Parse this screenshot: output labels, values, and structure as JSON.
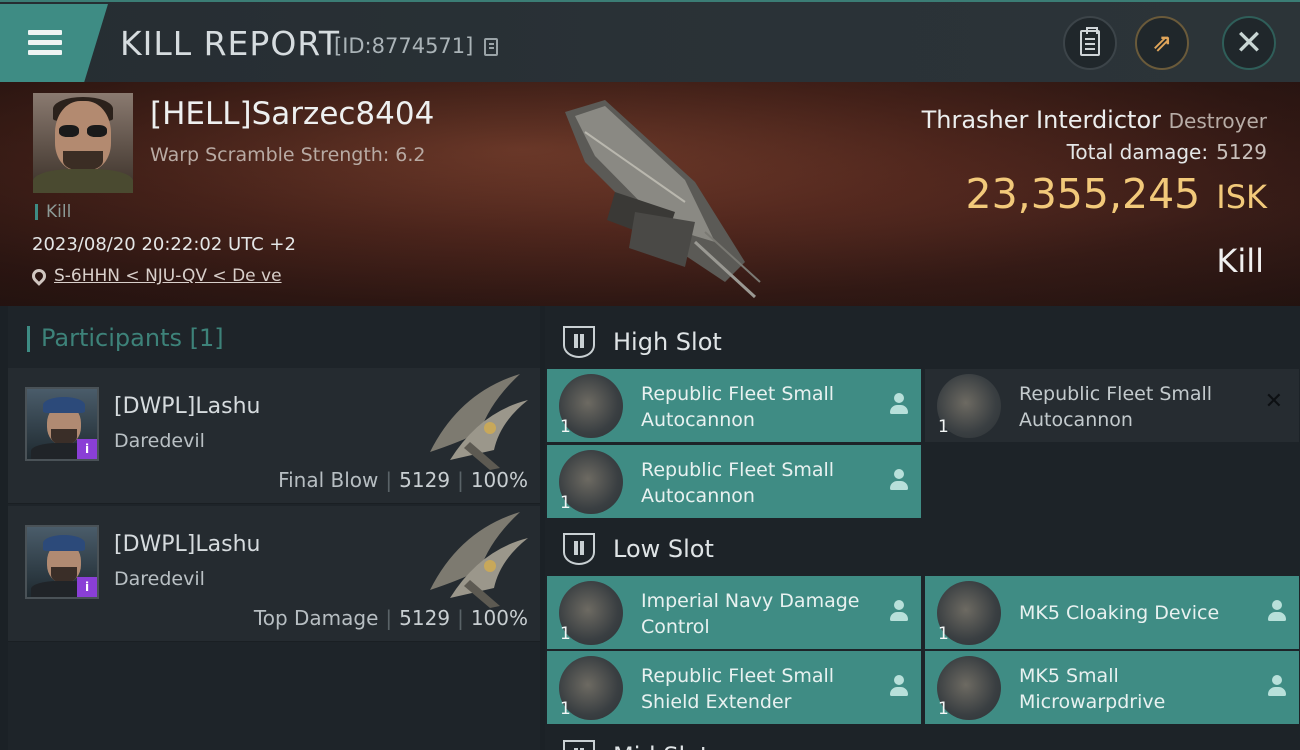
{
  "header": {
    "title": "KILL REPORT",
    "report_id": "[ID:8774571]",
    "menu_icon": "hamburger-menu-icon",
    "buttons": [
      {
        "icon": "clipboard-icon"
      },
      {
        "icon": "share-icon",
        "glyph": "⇗"
      },
      {
        "icon": "close-icon",
        "glyph": "✕"
      }
    ]
  },
  "victim": {
    "pilot": "[HELL]Sarzec8404",
    "scramble": "Warp Scramble Strength: 6.2",
    "kill_label": "Kill",
    "datetime": "2023/08/20 20:22:02 UTC +2",
    "location": "S-6HHN < NJU-QV < De ve",
    "ship_name": "Thrasher Interdictor",
    "ship_class": "Destroyer",
    "total_damage_label": "Total damage:",
    "total_damage": "5129",
    "isk_value": "23,355,245",
    "isk_unit": "ISK",
    "result": "Kill"
  },
  "participants": {
    "title": "Participants [1]",
    "rows": [
      {
        "name": "[DWPL]Lashu",
        "ship": "Daredevil",
        "label": "Final Blow",
        "damage": "5129",
        "percent": "100%",
        "badge": "i"
      },
      {
        "name": "[DWPL]Lashu",
        "ship": "Daredevil",
        "label": "Top Damage",
        "damage": "5129",
        "percent": "100%",
        "badge": "i"
      }
    ]
  },
  "slots": {
    "high": {
      "label": "High Slot",
      "items": [
        {
          "name": "Republic Fleet Small Autocannon",
          "qty": "1"
        },
        {
          "name": "Republic Fleet Small Autocannon",
          "qty": "1",
          "x_glyph": "✕"
        },
        {
          "name": "Republic Fleet Small Autocannon",
          "qty": "1"
        }
      ]
    },
    "low": {
      "label": "Low Slot",
      "items": [
        {
          "name": "Imperial Navy Damage Control",
          "qty": "1"
        },
        {
          "name": "MK5 Cloaking Device",
          "qty": "1"
        },
        {
          "name": "Republic Fleet Small Shield Extender",
          "qty": "1"
        },
        {
          "name": "MK5 Small Microwarpdrive",
          "qty": "1"
        }
      ]
    },
    "mid": {
      "label": "Mid Slot"
    }
  },
  "colors": {
    "accent": "#3e8c84",
    "isk": "#f2c97a",
    "badge": "#8a3fd6"
  }
}
